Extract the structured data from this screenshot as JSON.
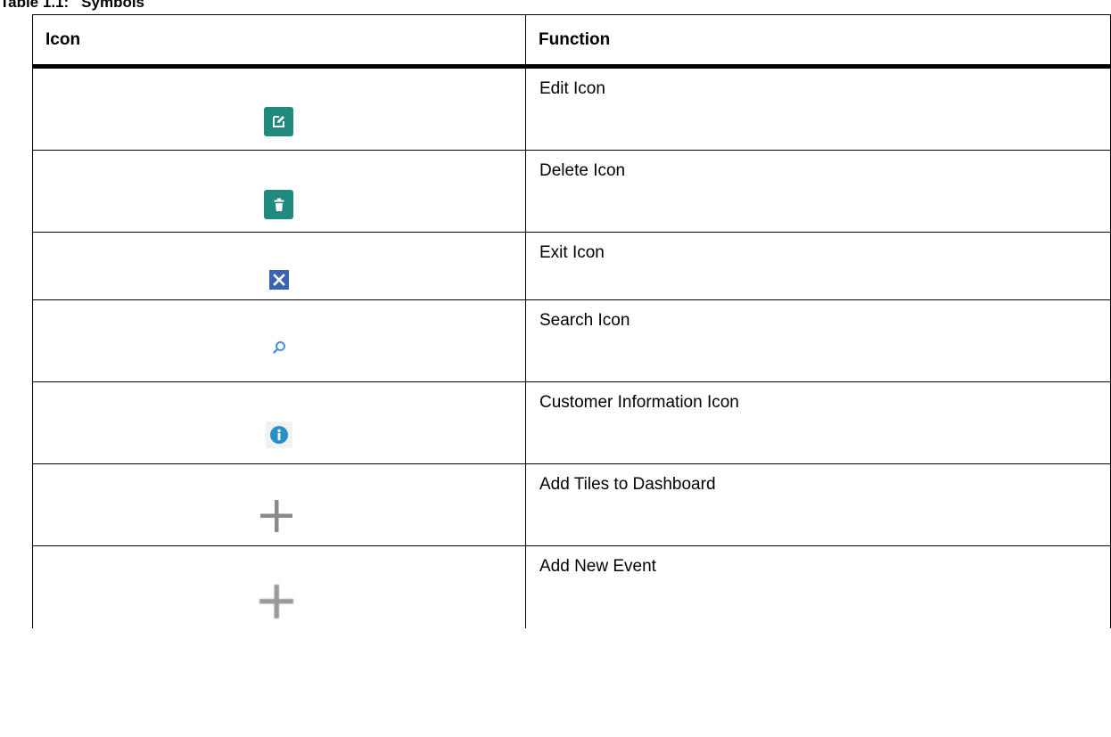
{
  "caption": {
    "number": "Table 1.1:",
    "title": "Symbols"
  },
  "table": {
    "headers": {
      "icon": "Icon",
      "function": "Function"
    },
    "rows": [
      {
        "icon": "edit-icon",
        "function": "Edit Icon"
      },
      {
        "icon": "delete-icon",
        "function": "Delete Icon"
      },
      {
        "icon": "exit-icon",
        "function": "Exit Icon"
      },
      {
        "icon": "search-icon",
        "function": "Search Icon"
      },
      {
        "icon": "info-icon",
        "function": "Customer Information Icon"
      },
      {
        "icon": "plus-icon",
        "function": "Add Tiles to Dashboard"
      },
      {
        "icon": "plus-icon",
        "function": "Add New Event"
      }
    ]
  },
  "colors": {
    "edit_delete_bg": "#1f8a7d",
    "exit_bg": "#3b63b4",
    "search": "#4a90e2",
    "info": "#2a8fc7",
    "plus": "#8a8a8a"
  }
}
